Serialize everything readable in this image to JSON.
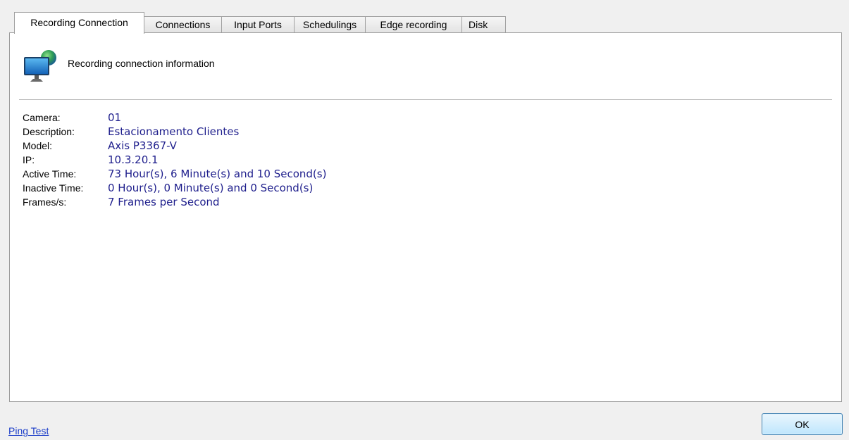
{
  "tabs": [
    {
      "label": "Recording Connection",
      "active": true
    },
    {
      "label": "Connections"
    },
    {
      "label": "Input Ports"
    },
    {
      "label": "Schedulings"
    },
    {
      "label": "Edge recording"
    },
    {
      "label": "Disk"
    }
  ],
  "panel": {
    "icon": "monitor-globe-icon",
    "title": "Recording connection information",
    "fields": [
      {
        "label": "Camera:",
        "value": "01"
      },
      {
        "label": "Description:",
        "value": "Estacionamento Clientes"
      },
      {
        "label": "Model:",
        "value": "Axis P3367-V"
      },
      {
        "label": "IP:",
        "value": "10.3.20.1"
      },
      {
        "label": "Active Time:",
        "value": "73 Hour(s), 6 Minute(s) and 10 Second(s)"
      },
      {
        "label": "Inactive Time:",
        "value": "0 Hour(s), 0 Minute(s) and 0 Second(s)"
      },
      {
        "label": "Frames/s:",
        "value": "7 Frames per Second"
      }
    ]
  },
  "footer": {
    "ping_link": "Ping Test",
    "ok_label": "OK"
  },
  "colors": {
    "value_text": "#1e1e8c",
    "link": "#1a3cc8",
    "ok_border": "#3c7fb1"
  }
}
